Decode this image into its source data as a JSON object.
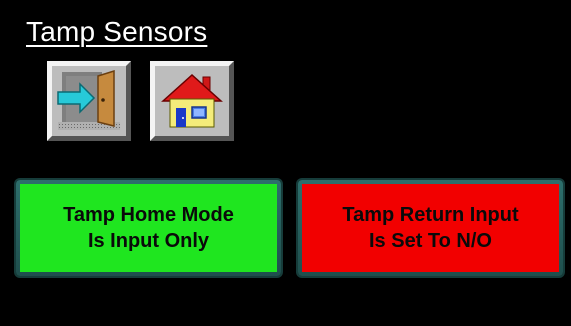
{
  "title": "Tamp Sensors",
  "nav": {
    "exit_icon": "exit-door-arrow",
    "home_icon": "house"
  },
  "status": {
    "home_mode": {
      "line1": "Tamp Home Mode",
      "line2": "Is Input Only",
      "color": "#1fe61f"
    },
    "return_input": {
      "line1": "Tamp Return Input",
      "line2": "Is Set To N/O",
      "color": "#f20000"
    }
  }
}
